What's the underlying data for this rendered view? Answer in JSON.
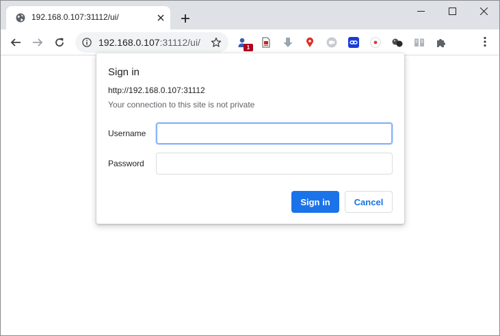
{
  "browser": {
    "tab": {
      "title": "192.168.0.107:31112/ui/",
      "favicon": "globe-icon"
    },
    "omnibox": {
      "host": "192.168.0.107",
      "path": ":31112/ui/"
    },
    "extensions": [
      {
        "name": "contacts-extension-icon",
        "badge": "1"
      },
      {
        "name": "pdf-extension-icon"
      },
      {
        "name": "download-arrow-extension-icon"
      },
      {
        "name": "map-pin-extension-icon"
      },
      {
        "name": "zoom-extension-icon"
      },
      {
        "name": "link-extension-icon"
      },
      {
        "name": "record-extension-icon"
      },
      {
        "name": "balls-extension-icon"
      },
      {
        "name": "reading-list-extension-icon"
      },
      {
        "name": "puzzle-extensions-icon"
      }
    ]
  },
  "dialog": {
    "title": "Sign in",
    "origin": "http://192.168.0.107:31112",
    "warning": "Your connection to this site is not private",
    "username_label": "Username",
    "username_value": "",
    "password_label": "Password",
    "password_value": "",
    "signin_button": "Sign in",
    "cancel_button": "Cancel"
  },
  "colors": {
    "accent": "#1a73e8",
    "tabstrip": "#dee1e6",
    "omnibox_bg": "#f1f3f4"
  }
}
